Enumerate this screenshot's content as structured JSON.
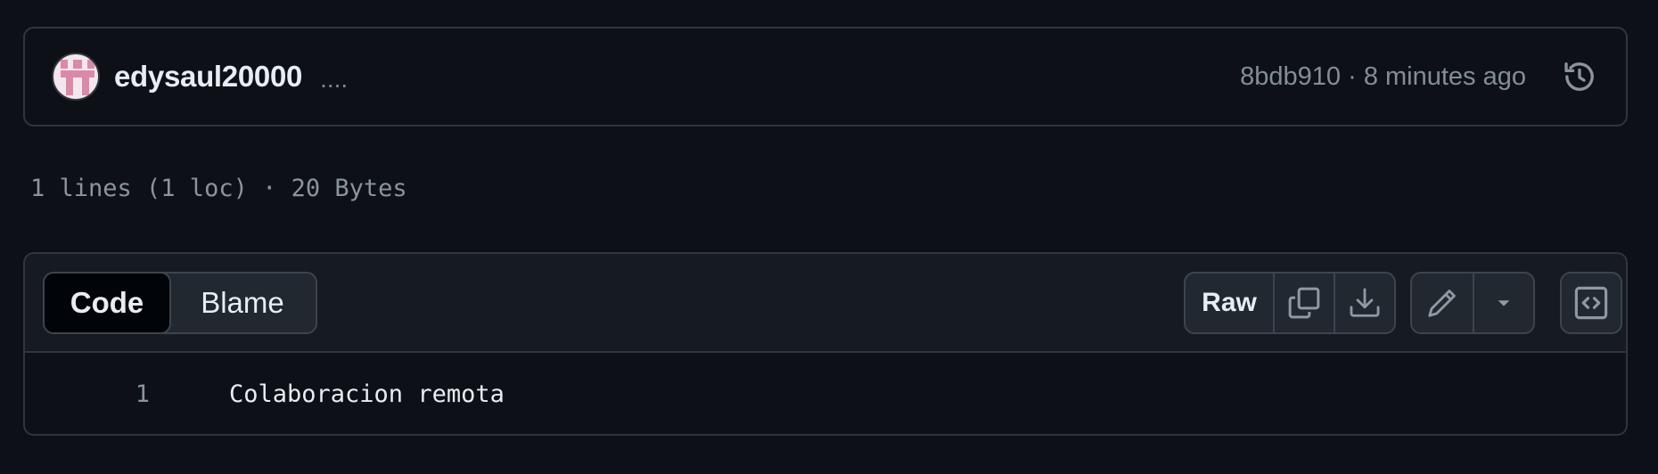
{
  "commit": {
    "author": "edysaul20000",
    "message": "....",
    "hash": "8bdb910",
    "separator": " · ",
    "time": "8 minutes ago",
    "icons": {
      "avatar": "identicon-avatar",
      "history": "history-icon"
    }
  },
  "file_info": {
    "lines": "1 lines (1 loc)",
    "separator": " · ",
    "size": "20 Bytes"
  },
  "toolbar": {
    "tabs": [
      {
        "label": "Code",
        "selected": true
      },
      {
        "label": "Blame",
        "selected": false
      }
    ],
    "raw_label": "Raw",
    "icons": {
      "copy": "copy-icon",
      "download": "download-icon",
      "edit": "pencil-icon",
      "dropdown": "triangle-down-icon",
      "symbols": "code-square-icon"
    }
  },
  "code": {
    "lines": [
      {
        "number": "1",
        "text": "Colaboracion remota"
      }
    ]
  },
  "colors": {
    "background": "#0d1117",
    "border": "#30363d",
    "text": "#e6edf3",
    "muted": "#848d97",
    "avatar_pink": "#d98aa9"
  }
}
